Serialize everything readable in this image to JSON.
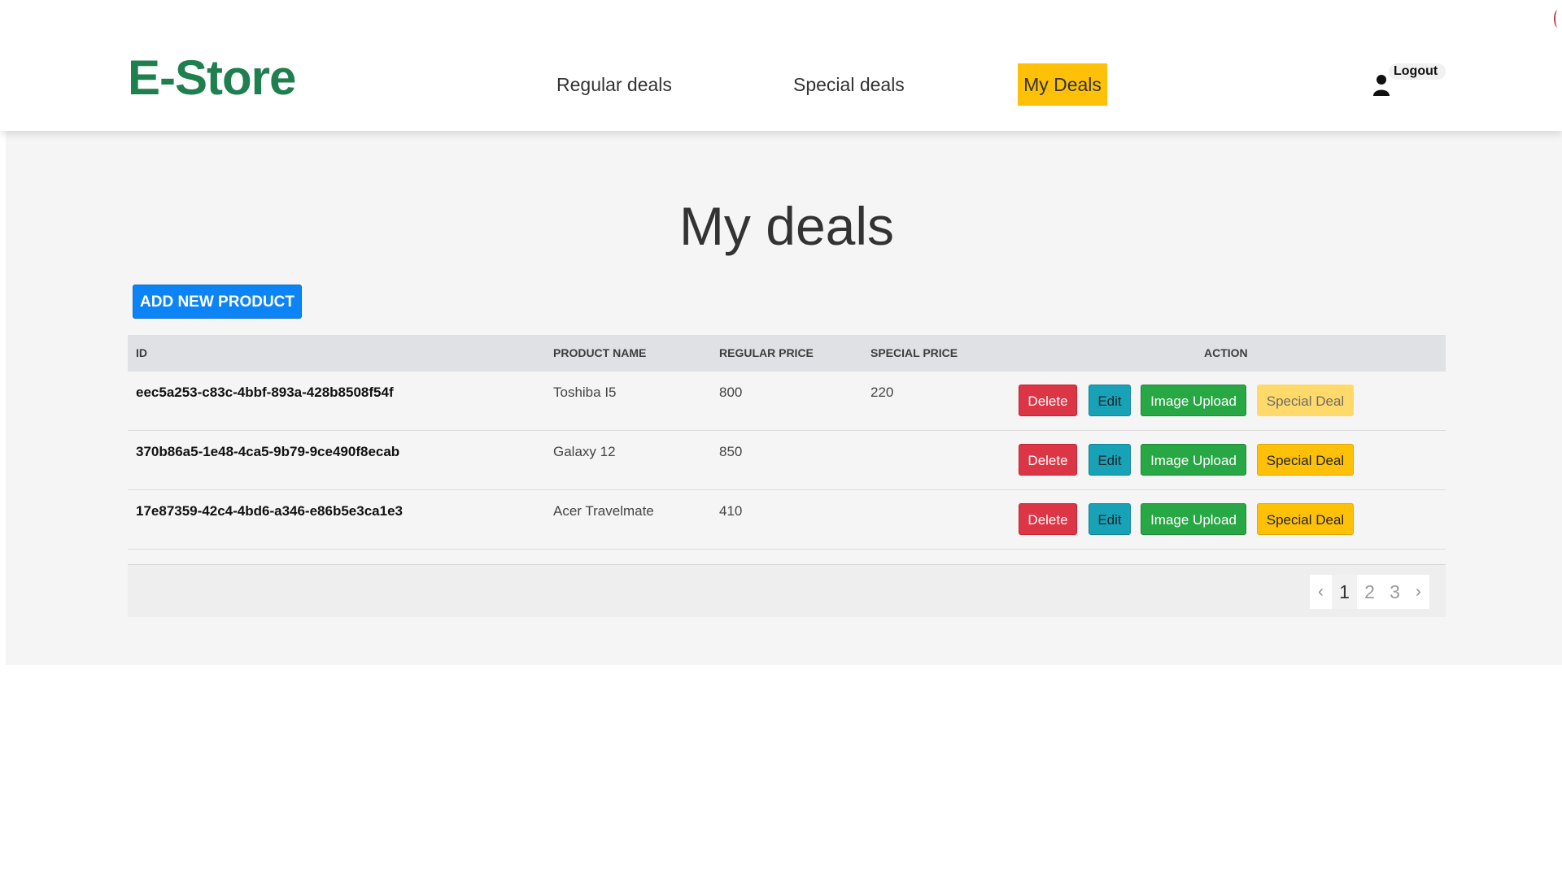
{
  "header": {
    "logo": "E-Store",
    "nav": {
      "regular": "Regular deals",
      "special": "Special deals",
      "mydeals": "My Deals"
    },
    "logout": "Logout"
  },
  "main": {
    "title": "My deals",
    "add_button": "ADD NEW PRODUCT"
  },
  "table": {
    "columns": {
      "id": "ID",
      "name": "PRODUCT NAME",
      "regular": "REGULAR PRICE",
      "special": "SPECIAL PRICE",
      "action": "ACTION"
    },
    "rows": [
      {
        "id": "eec5a253-c83c-4bbf-893a-428b8508f54f",
        "name": "Toshiba I5",
        "regular": "800",
        "special": "220"
      },
      {
        "id": "370b86a5-1e48-4ca5-9b79-9ce490f8ecab",
        "name": "Galaxy 12",
        "regular": "850",
        "special": ""
      },
      {
        "id": "17e87359-42c4-4bd6-a346-e86b5e3ca1e3",
        "name": "Acer Travelmate",
        "regular": "410",
        "special": ""
      }
    ],
    "actions": {
      "delete": "Delete",
      "edit": "Edit",
      "upload": "Image Upload",
      "special": "Special Deal"
    }
  },
  "pagination": {
    "prev": "‹",
    "pages": [
      "1",
      "2",
      "3"
    ],
    "next": "›",
    "current": "1"
  },
  "colors": {
    "brand": "#1f7f4f",
    "active_nav": "#ffc107",
    "primary": "#0d84f5",
    "danger": "#dc3545",
    "info": "#17a2b8",
    "success": "#28a745",
    "warning": "#ffc107"
  }
}
